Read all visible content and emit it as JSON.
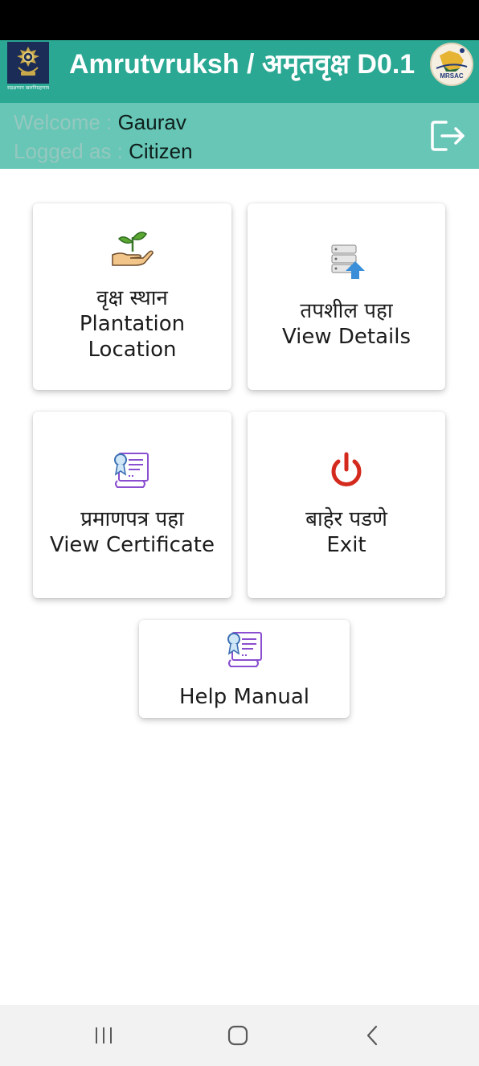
{
  "header": {
    "title": "Amrutvruksh / अमृतवृक्ष D0.1",
    "emblem_caption": "सद्रक्षणाय खलनिग्रहणाय",
    "partner_logo_text": "MRSAC"
  },
  "user": {
    "welcome_label": "Welcome : ",
    "name": "Gaurav",
    "logged_label": "Logged as : ",
    "role": "Citizen"
  },
  "tiles": [
    {
      "line1": "वृक्ष स्थान",
      "line2": "Plantation",
      "line3": "Location",
      "icon": "plant-hand-icon"
    },
    {
      "line1": "तपशील पहा",
      "line2": "View Details",
      "icon": "database-upload-icon"
    },
    {
      "line1": "प्रमाणपत्र पहा",
      "line2": "View Certificate",
      "icon": "certificate-icon"
    },
    {
      "line1": "बाहेर पडणे",
      "line2": "Exit",
      "icon": "power-icon"
    }
  ],
  "help": {
    "label": "Help Manual",
    "icon": "certificate-icon"
  },
  "colors": {
    "app_bar": "#2aa893",
    "user_strip": "#67c6b6",
    "power_red": "#d42a1e",
    "certificate_purple": "#8a4fd0"
  },
  "nav": {
    "recents": "recents-icon",
    "home": "home-icon",
    "back": "back-icon"
  }
}
